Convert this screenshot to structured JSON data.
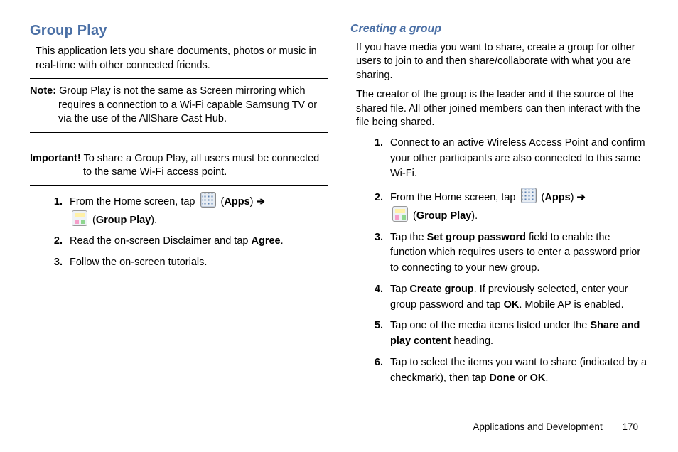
{
  "left": {
    "heading": "Group Play",
    "intro": "This application lets you share documents, photos or music in real-time with other connected friends.",
    "note_label": "Note:",
    "note_text": " Group Play is not the same as Screen mirroring which requires a connection to a Wi-Fi capable Samsung TV or via the use of the AllShare Cast Hub.",
    "important_label": "Important!",
    "important_text": " To share a Group Play, all users must be connected to the same Wi-Fi access point.",
    "steps": {
      "s1_a": "From the Home screen, tap ",
      "s1_apps_open": " (",
      "s1_apps": "Apps",
      "s1_apps_close": ") ",
      "s1_arrow": "➔",
      "s1_gp_open": " (",
      "s1_gp": "Group Play",
      "s1_gp_close": ").",
      "s2_a": "Read the on-screen Disclaimer and tap ",
      "s2_b": "Agree",
      "s2_c": ".",
      "s3": "Follow the on-screen tutorials."
    }
  },
  "right": {
    "heading": "Creating a group",
    "p1": "If you have media you want to share, create a group for other users to join to and then share/collaborate with what you are sharing.",
    "p2": "The creator of the group is the leader and it the source of the shared file. All other joined members can then interact with the file being shared.",
    "steps": {
      "s1": "Connect to an active Wireless Access Point and confirm your other participants are also connected to this same Wi-Fi.",
      "s2_a": "From the Home screen, tap ",
      "s2_apps_open": " (",
      "s2_apps": "Apps",
      "s2_apps_close": ") ",
      "s2_arrow": "➔",
      "s2_gp_open": " (",
      "s2_gp": "Group Play",
      "s2_gp_close": ").",
      "s3_a": "Tap the ",
      "s3_b": "Set group password",
      "s3_c": " field to enable the function which requires users to enter a password prior to connecting to your new group.",
      "s4_a": "Tap ",
      "s4_b": "Create group",
      "s4_c": ". If previously selected, enter your group password and tap ",
      "s4_d": "OK",
      "s4_e": ". Mobile AP is enabled.",
      "s5_a": "Tap one of the media items listed under the ",
      "s5_b": "Share and play content",
      "s5_c": " heading.",
      "s6_a": "Tap to select the items you want to share (indicated by a checkmark), then tap ",
      "s6_b": "Done",
      "s6_c": " or ",
      "s6_d": "OK",
      "s6_e": "."
    }
  },
  "footer": {
    "section": "Applications and Development",
    "page": "170"
  }
}
